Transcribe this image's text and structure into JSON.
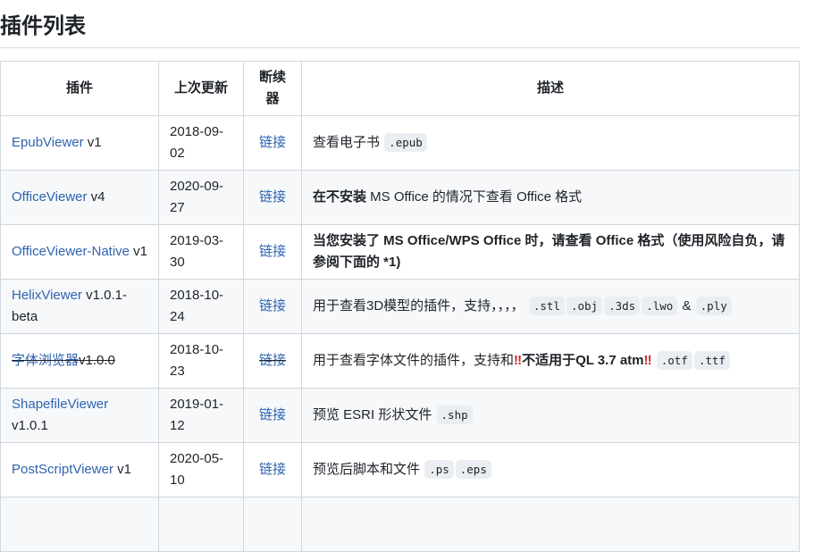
{
  "title": "插件列表",
  "headers": [
    "插件",
    "上次更新",
    "断续器",
    "描述"
  ],
  "rows": [
    {
      "name": "EpubViewer",
      "version": " v1",
      "date": "2018-09-02",
      "link": "链接",
      "strike": false,
      "desc": [
        {
          "k": "text",
          "t": "查看电子书 "
        },
        {
          "k": "code",
          "t": ".epub"
        }
      ]
    },
    {
      "name": "OfficeViewer",
      "version": " v4",
      "date": "2020-09-27",
      "link": "链接",
      "strike": false,
      "desc": [
        {
          "k": "bold",
          "t": "在不安装"
        },
        {
          "k": "text",
          "t": " MS Office 的情况下查看 Office 格式"
        }
      ]
    },
    {
      "name": "OfficeViewer-Native",
      "version": " v1",
      "date": "2019-03-30",
      "link": "链接",
      "strike": false,
      "desc": [
        {
          "k": "bold",
          "t": "当您安装了 MS Office/WPS Office 时，请查看 Office 格式（使用风险自负，请参阅下面的 *1)"
        }
      ]
    },
    {
      "name": "HelixViewer",
      "version": " v1.0.1-beta",
      "date": "2018-10-24",
      "link": "链接",
      "strike": false,
      "desc": [
        {
          "k": "text",
          "t": "用于查看3D模型的插件，支持，，，， "
        },
        {
          "k": "code",
          "t": ".stl"
        },
        {
          "k": "code",
          "t": ".obj"
        },
        {
          "k": "code",
          "t": ".3ds"
        },
        {
          "k": "code",
          "t": ".lwo"
        },
        {
          "k": "text",
          "t": " & "
        },
        {
          "k": "code",
          "t": ".ply"
        }
      ]
    },
    {
      "name": "字体浏览器",
      "version": "v1.0.0",
      "date": "2018-10-23",
      "link": "链接",
      "strike": true,
      "desc": [
        {
          "k": "text",
          "t": "用于查看字体文件的插件，支持和"
        },
        {
          "k": "emoji",
          "t": "‼"
        },
        {
          "k": "bold",
          "t": "不适用于QL 3.7 atm"
        },
        {
          "k": "emoji",
          "t": "‼"
        },
        {
          "k": "text",
          "t": " "
        },
        {
          "k": "code",
          "t": ".otf"
        },
        {
          "k": "code",
          "t": ".ttf"
        }
      ]
    },
    {
      "name": "ShapefileViewer",
      "version": " v1.0.1",
      "date": "2019-01-12",
      "link": "链接",
      "strike": false,
      "desc": [
        {
          "k": "text",
          "t": "预览 ESRI 形状文件 "
        },
        {
          "k": "code",
          "t": ".shp"
        }
      ]
    },
    {
      "name": "PostScriptViewer",
      "version": " v1",
      "date": "2020-05-10",
      "link": "链接",
      "strike": false,
      "desc": [
        {
          "k": "text",
          "t": "预览后脚本和文件 "
        },
        {
          "k": "code",
          "t": ".ps"
        },
        {
          "k": "code",
          "t": ".eps"
        }
      ]
    },
    {
      "name": "",
      "version": "",
      "date": "",
      "link": "",
      "strike": false,
      "desc": []
    }
  ]
}
